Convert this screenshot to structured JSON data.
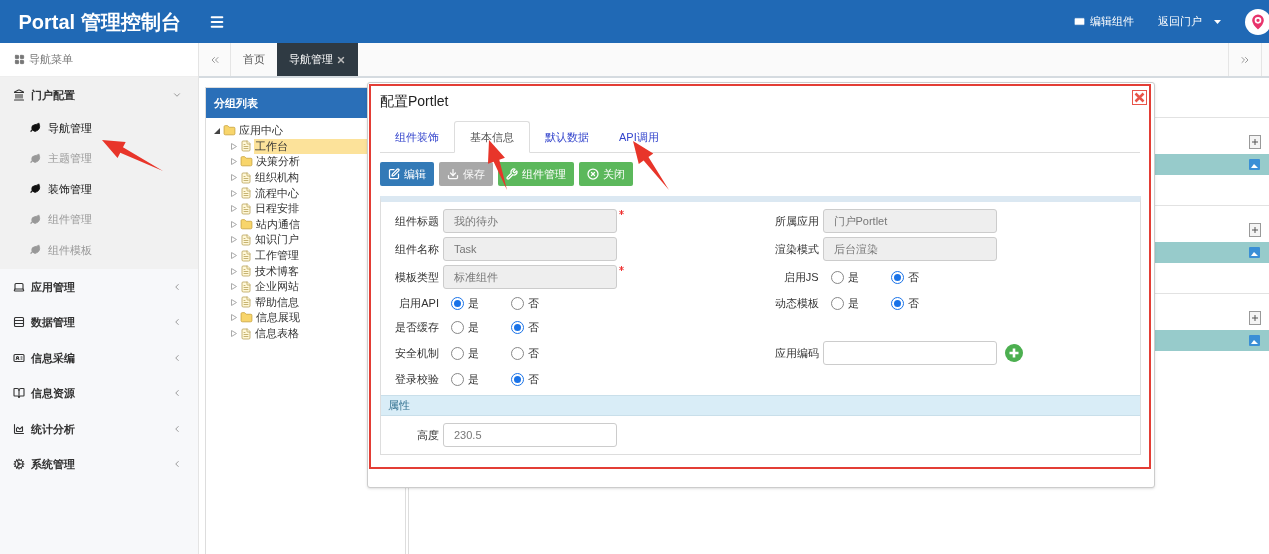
{
  "header": {
    "brand": "Portal 管理控制台",
    "actions": [
      {
        "label": "编辑组件",
        "kind": "card"
      },
      {
        "label": "返回门户",
        "kind": "dropdown"
      }
    ]
  },
  "sidebar": {
    "title": "导航菜单",
    "groups": [
      {
        "label": "门户配置",
        "expanded": true,
        "children": [
          {
            "label": "导航管理",
            "active": true
          },
          {
            "label": "主题管理",
            "active": false
          },
          {
            "label": "装饰管理",
            "active": true
          },
          {
            "label": "组件管理",
            "active": false
          },
          {
            "label": "组件模板",
            "active": false
          }
        ]
      },
      {
        "label": "应用管理",
        "expanded": false
      },
      {
        "label": "数据管理",
        "expanded": false
      },
      {
        "label": "信息采编",
        "expanded": false
      },
      {
        "label": "信息资源",
        "expanded": false
      },
      {
        "label": "统计分析",
        "expanded": false
      },
      {
        "label": "系统管理",
        "expanded": false
      }
    ]
  },
  "tabs": [
    {
      "label": "首页",
      "selected": false,
      "closable": false
    },
    {
      "label": "导航管理",
      "selected": true,
      "closable": true
    }
  ],
  "group_panel": {
    "title": "分组列表",
    "tree": [
      {
        "label": "应用中心",
        "kind": "folder",
        "expanded": true,
        "selected": false,
        "children": [
          {
            "label": "工作台",
            "kind": "file",
            "selected": true
          },
          {
            "label": "决策分析",
            "kind": "folder",
            "selected": false
          },
          {
            "label": "组织机构",
            "kind": "file",
            "selected": false
          },
          {
            "label": "流程中心",
            "kind": "file",
            "selected": false
          },
          {
            "label": "日程安排",
            "kind": "file",
            "selected": false
          },
          {
            "label": "站内通信",
            "kind": "folder",
            "selected": false
          },
          {
            "label": "知识门户",
            "kind": "file",
            "selected": false
          },
          {
            "label": "工作管理",
            "kind": "file",
            "selected": false
          },
          {
            "label": "技术博客",
            "kind": "file",
            "selected": false
          },
          {
            "label": "企业网站",
            "kind": "file",
            "selected": false
          },
          {
            "label": "帮助信息",
            "kind": "file",
            "selected": false
          },
          {
            "label": "信息展现",
            "kind": "folder",
            "selected": false
          },
          {
            "label": "信息表格",
            "kind": "file",
            "selected": false
          }
        ]
      }
    ]
  },
  "dialog": {
    "title": "配置Portlet",
    "tabs": [
      {
        "label": "组件装饰",
        "selected": false
      },
      {
        "label": "基本信息",
        "selected": true
      },
      {
        "label": "默认数据",
        "selected": false
      },
      {
        "label": "API调用",
        "selected": false
      }
    ],
    "buttons": [
      {
        "label": "编辑",
        "kind": "edit",
        "disabled": false
      },
      {
        "label": "保存",
        "kind": "save",
        "disabled": true
      },
      {
        "label": "组件管理",
        "kind": "manage",
        "disabled": false
      },
      {
        "label": "关闭",
        "kind": "close",
        "disabled": false
      }
    ],
    "rows": [
      {
        "left": {
          "kind": "text",
          "label": "组件标题",
          "value": "我的待办",
          "readonly": true,
          "required": true
        },
        "right": {
          "kind": "text",
          "label": "所属应用",
          "value": "门户Portlet",
          "readonly": true,
          "required": false
        }
      },
      {
        "left": {
          "kind": "text",
          "label": "组件名称",
          "value": "Task",
          "readonly": true,
          "required": false
        },
        "right": {
          "kind": "text",
          "label": "渲染模式",
          "value": "后台渲染",
          "readonly": true,
          "required": false
        }
      },
      {
        "left": {
          "kind": "text",
          "label": "模板类型",
          "value": "标准组件",
          "readonly": true,
          "required": true
        },
        "right": {
          "kind": "radio",
          "label": "启用JS",
          "options": [
            {
              "label": "是",
              "selected": false
            },
            {
              "label": "否",
              "selected": true
            }
          ]
        }
      },
      {
        "left": {
          "kind": "radio",
          "label": "启用API",
          "options": [
            {
              "label": "是",
              "selected": true
            },
            {
              "label": "否",
              "selected": false
            }
          ]
        },
        "right": {
          "kind": "radio",
          "label": "动态模板",
          "options": [
            {
              "label": "是",
              "selected": false
            },
            {
              "label": "否",
              "selected": true
            }
          ]
        }
      },
      {
        "left": {
          "kind": "radio",
          "label": "是否缓存",
          "options": [
            {
              "label": "是",
              "selected": false
            },
            {
              "label": "否",
              "selected": true
            }
          ]
        }
      },
      {
        "left": {
          "kind": "radio",
          "label": "安全机制",
          "options": [
            {
              "label": "是",
              "selected": false
            },
            {
              "label": "否",
              "selected": false
            }
          ]
        },
        "right": {
          "kind": "text",
          "label": "应用编码",
          "readonly": false,
          "required": false,
          "add_button": true
        }
      },
      {
        "left": {
          "kind": "radio",
          "label": "登录校验",
          "options": [
            {
              "label": "是",
              "selected": false
            },
            {
              "label": "否",
              "selected": true
            }
          ]
        }
      }
    ],
    "section": {
      "title": "属性",
      "rows": [
        {
          "left": {
            "kind": "text",
            "label": "高度",
            "value": "230.5",
            "readonly": false,
            "required": false
          }
        }
      ]
    }
  }
}
